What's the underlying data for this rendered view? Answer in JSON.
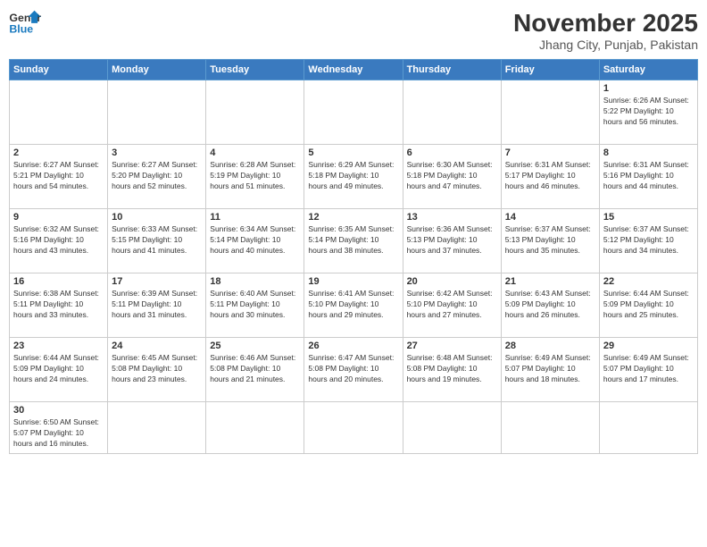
{
  "logo": {
    "text_general": "General",
    "text_blue": "Blue"
  },
  "header": {
    "month_year": "November 2025",
    "location": "Jhang City, Punjab, Pakistan"
  },
  "weekdays": [
    "Sunday",
    "Monday",
    "Tuesday",
    "Wednesday",
    "Thursday",
    "Friday",
    "Saturday"
  ],
  "weeks": [
    [
      {
        "day": "",
        "info": ""
      },
      {
        "day": "",
        "info": ""
      },
      {
        "day": "",
        "info": ""
      },
      {
        "day": "",
        "info": ""
      },
      {
        "day": "",
        "info": ""
      },
      {
        "day": "",
        "info": ""
      },
      {
        "day": "1",
        "info": "Sunrise: 6:26 AM\nSunset: 5:22 PM\nDaylight: 10 hours and 56 minutes."
      }
    ],
    [
      {
        "day": "2",
        "info": "Sunrise: 6:27 AM\nSunset: 5:21 PM\nDaylight: 10 hours and 54 minutes."
      },
      {
        "day": "3",
        "info": "Sunrise: 6:27 AM\nSunset: 5:20 PM\nDaylight: 10 hours and 52 minutes."
      },
      {
        "day": "4",
        "info": "Sunrise: 6:28 AM\nSunset: 5:19 PM\nDaylight: 10 hours and 51 minutes."
      },
      {
        "day": "5",
        "info": "Sunrise: 6:29 AM\nSunset: 5:18 PM\nDaylight: 10 hours and 49 minutes."
      },
      {
        "day": "6",
        "info": "Sunrise: 6:30 AM\nSunset: 5:18 PM\nDaylight: 10 hours and 47 minutes."
      },
      {
        "day": "7",
        "info": "Sunrise: 6:31 AM\nSunset: 5:17 PM\nDaylight: 10 hours and 46 minutes."
      },
      {
        "day": "8",
        "info": "Sunrise: 6:31 AM\nSunset: 5:16 PM\nDaylight: 10 hours and 44 minutes."
      }
    ],
    [
      {
        "day": "9",
        "info": "Sunrise: 6:32 AM\nSunset: 5:16 PM\nDaylight: 10 hours and 43 minutes."
      },
      {
        "day": "10",
        "info": "Sunrise: 6:33 AM\nSunset: 5:15 PM\nDaylight: 10 hours and 41 minutes."
      },
      {
        "day": "11",
        "info": "Sunrise: 6:34 AM\nSunset: 5:14 PM\nDaylight: 10 hours and 40 minutes."
      },
      {
        "day": "12",
        "info": "Sunrise: 6:35 AM\nSunset: 5:14 PM\nDaylight: 10 hours and 38 minutes."
      },
      {
        "day": "13",
        "info": "Sunrise: 6:36 AM\nSunset: 5:13 PM\nDaylight: 10 hours and 37 minutes."
      },
      {
        "day": "14",
        "info": "Sunrise: 6:37 AM\nSunset: 5:13 PM\nDaylight: 10 hours and 35 minutes."
      },
      {
        "day": "15",
        "info": "Sunrise: 6:37 AM\nSunset: 5:12 PM\nDaylight: 10 hours and 34 minutes."
      }
    ],
    [
      {
        "day": "16",
        "info": "Sunrise: 6:38 AM\nSunset: 5:11 PM\nDaylight: 10 hours and 33 minutes."
      },
      {
        "day": "17",
        "info": "Sunrise: 6:39 AM\nSunset: 5:11 PM\nDaylight: 10 hours and 31 minutes."
      },
      {
        "day": "18",
        "info": "Sunrise: 6:40 AM\nSunset: 5:11 PM\nDaylight: 10 hours and 30 minutes."
      },
      {
        "day": "19",
        "info": "Sunrise: 6:41 AM\nSunset: 5:10 PM\nDaylight: 10 hours and 29 minutes."
      },
      {
        "day": "20",
        "info": "Sunrise: 6:42 AM\nSunset: 5:10 PM\nDaylight: 10 hours and 27 minutes."
      },
      {
        "day": "21",
        "info": "Sunrise: 6:43 AM\nSunset: 5:09 PM\nDaylight: 10 hours and 26 minutes."
      },
      {
        "day": "22",
        "info": "Sunrise: 6:44 AM\nSunset: 5:09 PM\nDaylight: 10 hours and 25 minutes."
      }
    ],
    [
      {
        "day": "23",
        "info": "Sunrise: 6:44 AM\nSunset: 5:09 PM\nDaylight: 10 hours and 24 minutes."
      },
      {
        "day": "24",
        "info": "Sunrise: 6:45 AM\nSunset: 5:08 PM\nDaylight: 10 hours and 23 minutes."
      },
      {
        "day": "25",
        "info": "Sunrise: 6:46 AM\nSunset: 5:08 PM\nDaylight: 10 hours and 21 minutes."
      },
      {
        "day": "26",
        "info": "Sunrise: 6:47 AM\nSunset: 5:08 PM\nDaylight: 10 hours and 20 minutes."
      },
      {
        "day": "27",
        "info": "Sunrise: 6:48 AM\nSunset: 5:08 PM\nDaylight: 10 hours and 19 minutes."
      },
      {
        "day": "28",
        "info": "Sunrise: 6:49 AM\nSunset: 5:07 PM\nDaylight: 10 hours and 18 minutes."
      },
      {
        "day": "29",
        "info": "Sunrise: 6:49 AM\nSunset: 5:07 PM\nDaylight: 10 hours and 17 minutes."
      }
    ],
    [
      {
        "day": "30",
        "info": "Sunrise: 6:50 AM\nSunset: 5:07 PM\nDaylight: 10 hours and 16 minutes."
      },
      {
        "day": "",
        "info": ""
      },
      {
        "day": "",
        "info": ""
      },
      {
        "day": "",
        "info": ""
      },
      {
        "day": "",
        "info": ""
      },
      {
        "day": "",
        "info": ""
      },
      {
        "day": "",
        "info": ""
      }
    ]
  ]
}
